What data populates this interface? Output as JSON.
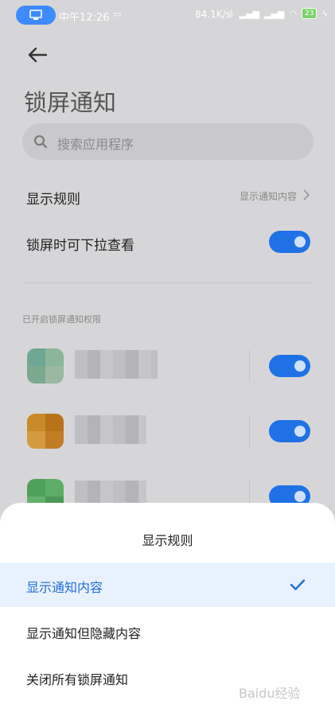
{
  "status_bar": {
    "time": "中午12:26",
    "net_speed": "84.1K/s",
    "battery": "23",
    "device_icon": "monitor-icon"
  },
  "header": {
    "title": "锁屏通知"
  },
  "search": {
    "placeholder": "搜索应用程序"
  },
  "settings": {
    "display_rule_label": "显示规则",
    "display_rule_value": "显示通知内容",
    "pull_down_label": "锁屏时可下拉查看",
    "pull_down_enabled": true
  },
  "section_label": "已开启锁屏通知权限",
  "apps": [
    {
      "enabled": true
    },
    {
      "enabled": true
    },
    {
      "enabled": true
    }
  ],
  "sheet": {
    "title": "显示规则",
    "options": [
      {
        "label": "显示通知内容",
        "selected": true
      },
      {
        "label": "显示通知但隐藏内容",
        "selected": false
      },
      {
        "label": "关闭所有锁屏通知",
        "selected": false
      }
    ]
  },
  "watermark": "Baidu经验",
  "colors": {
    "accent": "#1f72e6",
    "selected_bg": "#e8f1fe",
    "status_pill": "#3d8bff"
  }
}
